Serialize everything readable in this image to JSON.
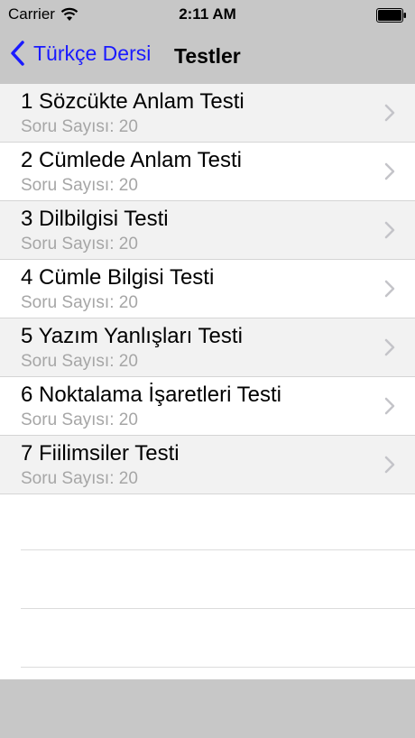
{
  "status_bar": {
    "carrier": "Carrier",
    "time": "2:11 AM"
  },
  "nav": {
    "back_label": "Türkçe Dersi",
    "title": "Testler"
  },
  "colors": {
    "accent": "#1a1aff",
    "bar_background": "#c7c7c7",
    "row_alt_background": "#f2f2f2",
    "subtitle_text": "#a6a6a6"
  },
  "tests": [
    {
      "title": "1 Sözcükte Anlam Testi",
      "subtitle": "Soru Sayısı: 20"
    },
    {
      "title": "2 Cümlede Anlam Testi",
      "subtitle": "Soru Sayısı: 20"
    },
    {
      "title": "3 Dilbilgisi Testi",
      "subtitle": "Soru Sayısı: 20"
    },
    {
      "title": "4 Cümle Bilgisi Testi",
      "subtitle": "Soru Sayısı: 20"
    },
    {
      "title": "5 Yazım Yanlışları Testi",
      "subtitle": "Soru Sayısı: 20"
    },
    {
      "title": "6 Noktalama İşaretleri Testi",
      "subtitle": "Soru Sayısı: 20"
    },
    {
      "title": "7 Fiilimsiler Testi",
      "subtitle": "Soru Sayısı: 20"
    }
  ]
}
